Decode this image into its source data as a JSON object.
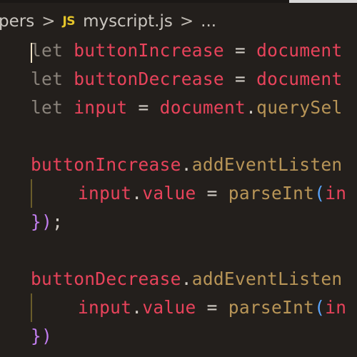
{
  "breadcrumb": {
    "segments": [
      "pers",
      "myscript.js",
      "..."
    ],
    "file_icon": "JS",
    "separator": ">"
  },
  "code_lines": [
    {
      "tokens": [
        "let",
        "buttonIncrease",
        "=",
        "document"
      ]
    },
    {
      "tokens": [
        "let",
        "buttonDecrease",
        "=",
        "document"
      ]
    },
    {
      "tokens": [
        "let",
        "input",
        "=",
        "document",
        ".",
        "querySel"
      ]
    },
    {
      "tokens": []
    },
    {
      "tokens": [
        "buttonIncrease",
        ".",
        "addEventListen"
      ]
    },
    {
      "tokens": [
        "input",
        ".",
        "value",
        "=",
        "parseInt",
        "(",
        "in"
      ]
    },
    {
      "tokens": [
        "}",
        ")",
        ";"
      ]
    },
    {
      "tokens": []
    },
    {
      "tokens": [
        "buttonDecrease",
        ".",
        "addEventListen"
      ]
    },
    {
      "tokens": [
        "input",
        ".",
        "value",
        "=",
        "parseInt",
        "(",
        "in"
      ]
    },
    {
      "tokens": [
        "}",
        ")"
      ]
    }
  ],
  "colors": {
    "background": "#231f1c",
    "keyword": "#8b847c",
    "variable": "#e8435b",
    "method": "#b89557",
    "bracket_level1": "#c27ef0",
    "bracket_level2": "#5aa6ff",
    "js_icon": "#e5c52a"
  }
}
